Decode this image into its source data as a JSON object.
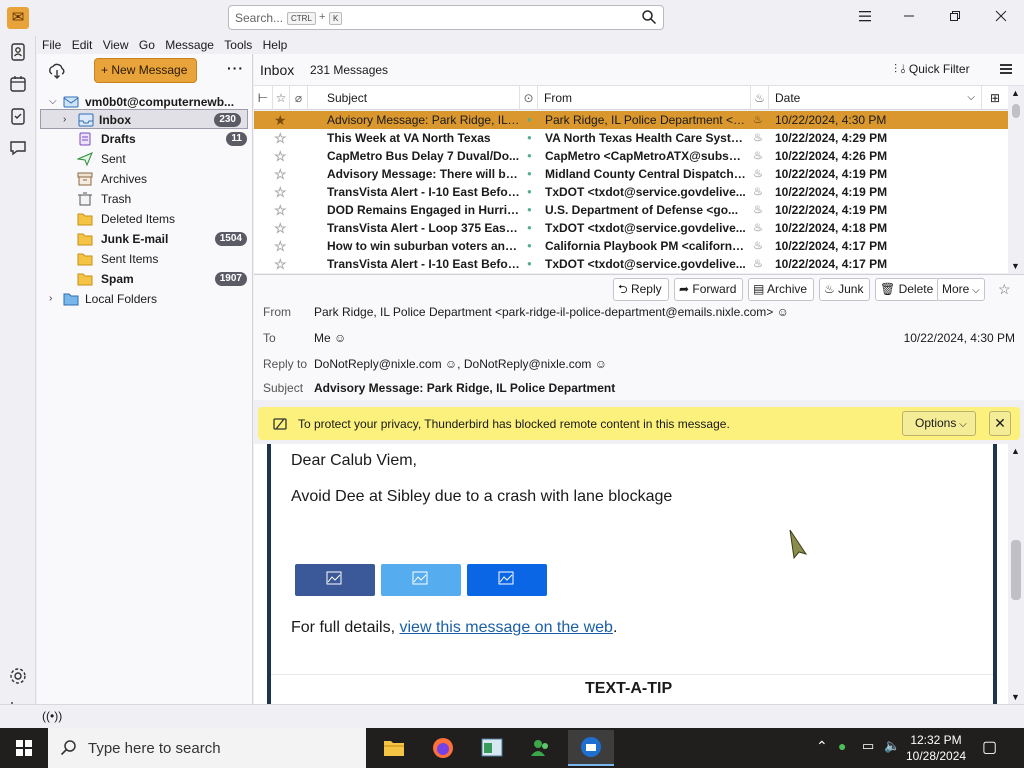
{
  "titlebar": {
    "search_placeholder": "Search...",
    "search_shortcut_ctrl": "CTRL",
    "search_shortcut_plus": "+",
    "search_shortcut_key": "K"
  },
  "menubar": [
    "File",
    "Edit",
    "View",
    "Go",
    "Message",
    "Tools",
    "Help"
  ],
  "folder_pane": {
    "new_message_label": "New Message",
    "more_label": "···",
    "account": "vm0b0t@computernewb...",
    "folders": [
      {
        "label": "Inbox",
        "badge": "230",
        "icon": "inbox-icon",
        "bold": true,
        "selected": true
      },
      {
        "label": "Drafts",
        "badge": "11",
        "icon": "drafts-icon",
        "bold": true
      },
      {
        "label": "Sent",
        "badge": "",
        "icon": "sent-icon"
      },
      {
        "label": "Archives",
        "badge": "",
        "icon": "archive-icon"
      },
      {
        "label": "Trash",
        "badge": "",
        "icon": "trash-icon"
      },
      {
        "label": "Deleted Items",
        "badge": "",
        "icon": "folder-icon"
      },
      {
        "label": "Junk E-mail",
        "badge": "1504",
        "icon": "folder-icon",
        "bold": true
      },
      {
        "label": "Sent Items",
        "badge": "",
        "icon": "folder-icon"
      },
      {
        "label": "Spam",
        "badge": "1907",
        "icon": "folder-icon",
        "bold": true
      }
    ],
    "local_folders": "Local Folders"
  },
  "thread_pane": {
    "folder_title": "Inbox",
    "message_count": "231 Messages",
    "quick_filter_label": "Quick Filter",
    "columns": {
      "subject": "Subject",
      "from": "From",
      "date": "Date"
    },
    "rows": [
      {
        "subject": "Advisory Message: Park Ridge, IL P...",
        "from": "Park Ridge, IL Police Department <p...",
        "date": "10/22/2024, 4:30 PM",
        "selected": true
      },
      {
        "subject": "This Week at VA North Texas",
        "from": "VA North Texas Health Care Syste...",
        "date": "10/22/2024, 4:29 PM"
      },
      {
        "subject": "CapMetro Bus Delay 7 Duval/Do...",
        "from": "CapMetro <CapMetroATX@subscr...",
        "date": "10/22/2024, 4:26 PM"
      },
      {
        "subject": "Advisory Message: There will be ...",
        "from": "Midland County Central Dispatch ...",
        "date": "10/22/2024, 4:19 PM"
      },
      {
        "subject": "TransVista Alert - I-10 East Befor...",
        "from": "TxDOT <txdot@service.govdelive...",
        "date": "10/22/2024, 4:19 PM"
      },
      {
        "subject": "DOD Remains Engaged in Hurric...",
        "from": "U.S. Department of Defense <go...",
        "date": "10/22/2024, 4:19 PM"
      },
      {
        "subject": "TransVista Alert - Loop 375 East ...",
        "from": "TxDOT <txdot@service.govdelive...",
        "date": "10/22/2024, 4:18 PM"
      },
      {
        "subject": "How to win suburban voters and...",
        "from": "California Playbook PM <california...",
        "date": "10/22/2024, 4:17 PM"
      },
      {
        "subject": "TransVista Alert - I-10 East Befor...",
        "from": "TxDOT <txdot@service.govdelive...",
        "date": "10/22/2024, 4:17 PM"
      }
    ]
  },
  "message_header": {
    "actions": {
      "reply": "Reply",
      "forward": "Forward",
      "archive": "Archive",
      "junk": "Junk",
      "delete": "Delete",
      "more": "More"
    },
    "labels": {
      "from": "From",
      "to": "To",
      "reply_to": "Reply to",
      "subject": "Subject"
    },
    "from": "Park Ridge, IL Police Department <park-ridge-il-police-department@emails.nixle.com>",
    "to": "Me",
    "reply_to_1": "DoNotReply@nixle.com",
    "reply_to_sep": ",",
    "reply_to_2": "DoNotReply@nixle.com",
    "subject": "Advisory Message: Park Ridge, IL Police Department",
    "date": "10/22/2024, 4:30 PM"
  },
  "remote_content": {
    "text": "To protect your privacy, Thunderbird has blocked remote content in this message.",
    "options_label": "Options"
  },
  "message_body": {
    "greeting": "Dear Calub Viem,",
    "alert": "Avoid Dee at Sibley due to a crash with lane blockage",
    "details_prefix": "For full details,",
    "details_link": "view this message on the web",
    "details_suffix": ".",
    "text_a_tip": "TEXT-A-TIP"
  },
  "taskbar": {
    "search_placeholder": "Type here to search",
    "time": "12:32 PM",
    "date": "10/28/2024"
  },
  "colors": {
    "accent": "#e8a33a",
    "selected_row": "#d9972e",
    "remote_bar": "#fbf17c",
    "link": "#1a5fa6",
    "social_facebook": "#3b5998",
    "social_twitter": "#55acee",
    "social_other": "#0a66e4"
  }
}
